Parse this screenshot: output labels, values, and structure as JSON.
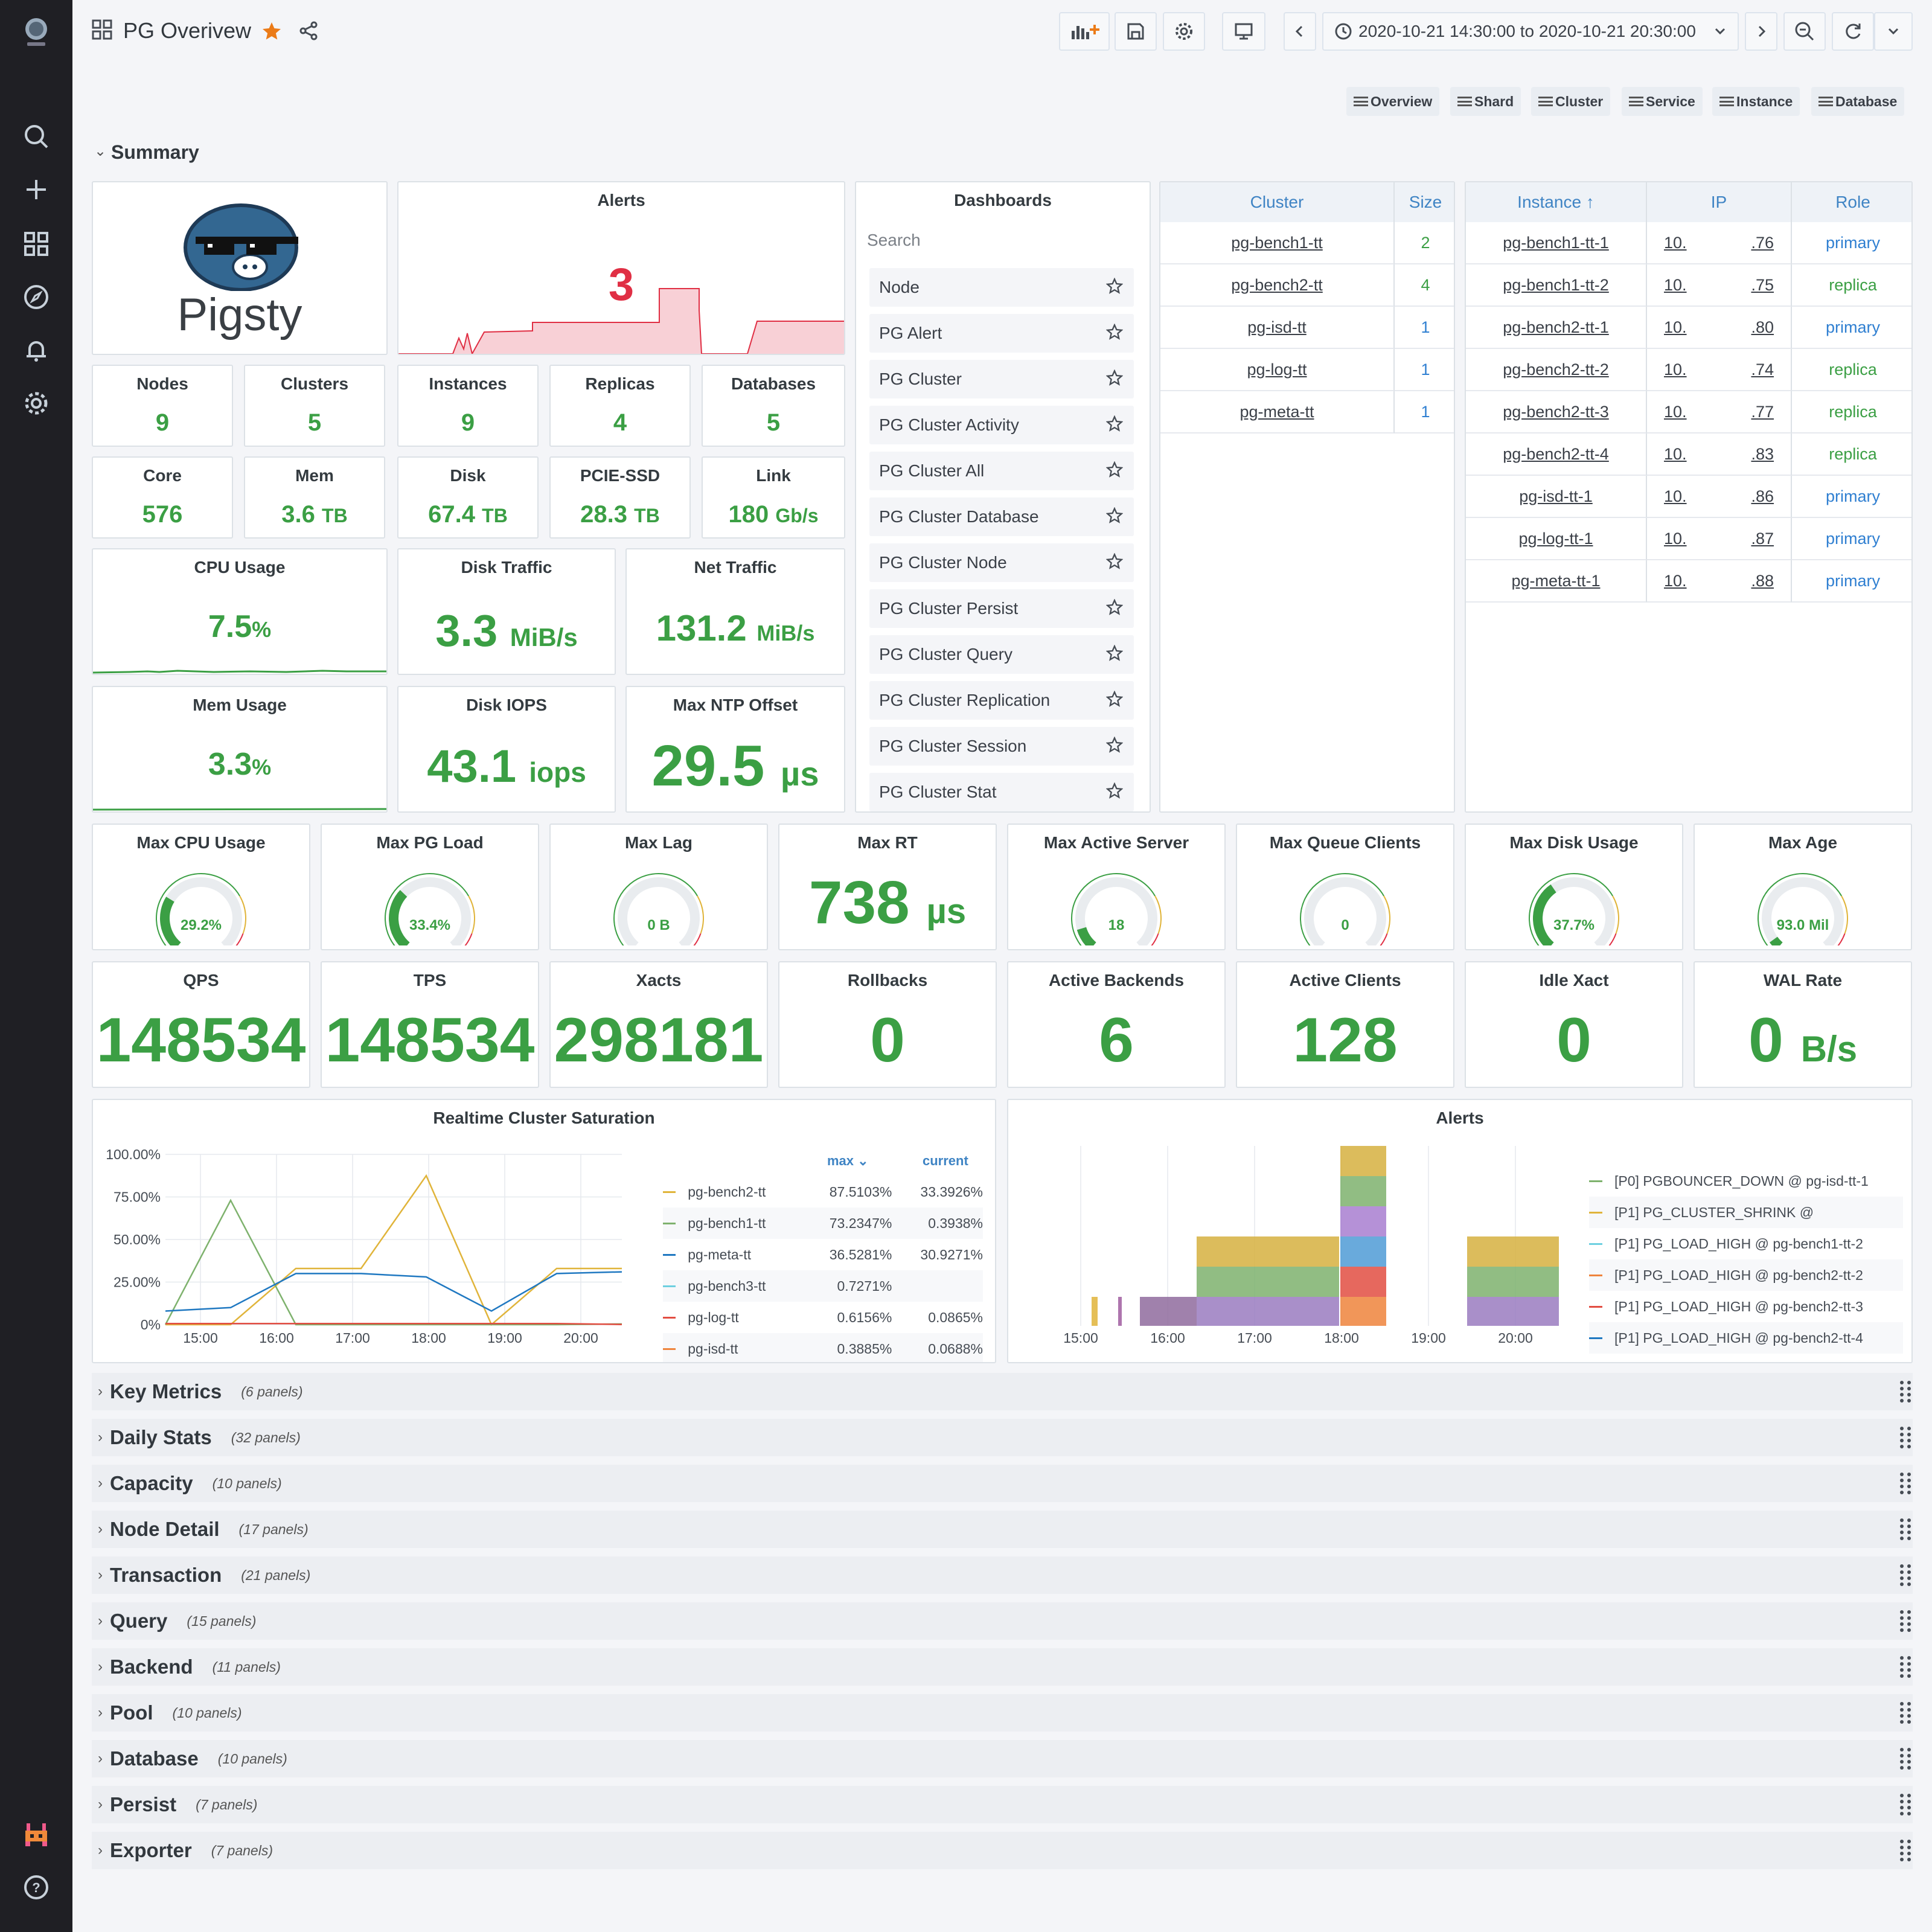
{
  "header": {
    "title": "PG Overivew",
    "time_range": "2020-10-21 14:30:00 to 2020-10-21 20:30:00",
    "links": [
      "Overview",
      "Shard",
      "Cluster",
      "Service",
      "Instance",
      "Database"
    ]
  },
  "summary": {
    "title": "Summary",
    "logo_text": "Pigsty",
    "alerts": {
      "title": "Alerts",
      "value": "3",
      "color": "#e02f44"
    },
    "counts": [
      {
        "label": "Nodes",
        "value": "9"
      },
      {
        "label": "Clusters",
        "value": "5"
      },
      {
        "label": "Instances",
        "value": "9"
      },
      {
        "label": "Replicas",
        "value": "4"
      },
      {
        "label": "Databases",
        "value": "5"
      }
    ],
    "resources": [
      {
        "label": "Core",
        "value": "576",
        "unit": ""
      },
      {
        "label": "Mem",
        "value": "3.6",
        "unit": "TB"
      },
      {
        "label": "Disk",
        "value": "67.4",
        "unit": "TB"
      },
      {
        "label": "PCIE-SSD",
        "value": "28.3",
        "unit": "TB"
      },
      {
        "label": "Link",
        "value": "180",
        "unit": "Gb/s"
      }
    ],
    "cpu_usage": {
      "label": "CPU Usage",
      "value": "7.5",
      "unit": "%"
    },
    "mem_usage": {
      "label": "Mem Usage",
      "value": "3.3",
      "unit": "%"
    },
    "disk_traffic": {
      "label": "Disk Traffic",
      "value": "3.3",
      "unit": "MiB/s"
    },
    "net_traffic": {
      "label": "Net Traffic",
      "value": "131.2",
      "unit": "MiB/s"
    },
    "disk_iops": {
      "label": "Disk IOPS",
      "value": "43.1",
      "unit": "iops"
    },
    "ntp_offset": {
      "label": "Max NTP Offset",
      "value": "29.5",
      "unit": "µs"
    }
  },
  "dashboards": {
    "title": "Dashboards",
    "search_placeholder": "Search",
    "items": [
      "Node",
      "PG Alert",
      "PG Cluster",
      "PG Cluster Activity",
      "PG Cluster All",
      "PG Cluster Database",
      "PG Cluster Node",
      "PG Cluster Persist",
      "PG Cluster Query",
      "PG Cluster Replication",
      "PG Cluster Session",
      "PG Cluster Stat"
    ]
  },
  "cluster_table": {
    "headers": [
      "Cluster",
      "Size"
    ],
    "rows": [
      {
        "cluster": "pg-bench1-tt",
        "size": "2"
      },
      {
        "cluster": "pg-bench2-tt",
        "size": "4"
      },
      {
        "cluster": "pg-isd-tt",
        "size": "1"
      },
      {
        "cluster": "pg-log-tt",
        "size": "1"
      },
      {
        "cluster": "pg-meta-tt",
        "size": "1"
      }
    ]
  },
  "instance_table": {
    "headers": [
      "Instance ↑",
      "IP",
      "Role"
    ],
    "rows": [
      {
        "instance": "pg-bench1-tt-1",
        "ip_a": "10.",
        "ip_b": ".76",
        "role": "primary"
      },
      {
        "instance": "pg-bench1-tt-2",
        "ip_a": "10.",
        "ip_b": ".75",
        "role": "replica"
      },
      {
        "instance": "pg-bench2-tt-1",
        "ip_a": "10.",
        "ip_b": ".80",
        "role": "primary"
      },
      {
        "instance": "pg-bench2-tt-2",
        "ip_a": "10.",
        "ip_b": ".74",
        "role": "replica"
      },
      {
        "instance": "pg-bench2-tt-3",
        "ip_a": "10.",
        "ip_b": ".77",
        "role": "replica"
      },
      {
        "instance": "pg-bench2-tt-4",
        "ip_a": "10.",
        "ip_b": ".83",
        "role": "replica"
      },
      {
        "instance": "pg-isd-tt-1",
        "ip_a": "10.",
        "ip_b": ".86",
        "role": "primary"
      },
      {
        "instance": "pg-log-tt-1",
        "ip_a": "10.",
        "ip_b": ".87",
        "role": "primary"
      },
      {
        "instance": "pg-meta-tt-1",
        "ip_a": "10.",
        "ip_b": ".88",
        "role": "primary"
      }
    ]
  },
  "gauges": [
    {
      "label": "Max CPU Usage",
      "text": "29.2%",
      "fraction": 0.292
    },
    {
      "label": "Max PG Load",
      "text": "33.4%",
      "fraction": 0.334
    },
    {
      "label": "Max Lag",
      "text": "0 B",
      "fraction": 0
    },
    {
      "label": "Max RT",
      "text": "738",
      "unit": "µs",
      "is_stat": true
    },
    {
      "label": "Max Active Server",
      "text": "18",
      "fraction": 0.12
    },
    {
      "label": "Max Queue Clients",
      "text": "0",
      "fraction": 0
    },
    {
      "label": "Max Disk Usage",
      "text": "37.7%",
      "fraction": 0.377
    },
    {
      "label": "Max Age",
      "text": "93.0 Mil",
      "fraction": 0.05
    }
  ],
  "db_stats": [
    {
      "label": "QPS",
      "value": "148534",
      "unit": ""
    },
    {
      "label": "TPS",
      "value": "148534",
      "unit": ""
    },
    {
      "label": "Xacts",
      "value": "298181",
      "unit": ""
    },
    {
      "label": "Rollbacks",
      "value": "0",
      "unit": ""
    },
    {
      "label": "Active Backends",
      "value": "6",
      "unit": ""
    },
    {
      "label": "Active Clients",
      "value": "128",
      "unit": ""
    },
    {
      "label": "Idle Xact",
      "value": "0",
      "unit": ""
    },
    {
      "label": "WAL Rate",
      "value": "0",
      "unit": "B/s"
    }
  ],
  "saturation": {
    "title": "Realtime Cluster Saturation",
    "legend_headers": {
      "max": "max",
      "current": "current"
    },
    "legend": [
      {
        "name": "pg-bench2-tt",
        "max": "87.5103%",
        "current": "33.3926%",
        "color": "#e0b43a"
      },
      {
        "name": "pg-bench1-tt",
        "max": "73.2347%",
        "current": "0.3938%",
        "color": "#7eb26d"
      },
      {
        "name": "pg-meta-tt",
        "max": "36.5281%",
        "current": "30.9271%",
        "color": "#1f78c1"
      },
      {
        "name": "pg-bench3-tt",
        "max": "0.7271%",
        "current": "",
        "color": "#6ed0e0"
      },
      {
        "name": "pg-log-tt",
        "max": "0.6156%",
        "current": "0.0865%",
        "color": "#e24d42"
      },
      {
        "name": "pg-isd-tt",
        "max": "0.3885%",
        "current": "0.0688%",
        "color": "#ef843c"
      }
    ]
  },
  "alerts_chart": {
    "title": "Alerts",
    "legend": [
      {
        "name": "[P0] PGBOUNCER_DOWN @ pg-isd-tt-1",
        "color": "#7eb26d"
      },
      {
        "name": "[P1] PG_CLUSTER_SHRINK @",
        "color": "#e0b43a"
      },
      {
        "name": "[P1] PG_LOAD_HIGH @ pg-bench1-tt-2",
        "color": "#6ed0e0"
      },
      {
        "name": "[P1] PG_LOAD_HIGH @ pg-bench2-tt-2",
        "color": "#ef843c"
      },
      {
        "name": "[P1] PG_LOAD_HIGH @ pg-bench2-tt-3",
        "color": "#e24d42"
      },
      {
        "name": "[P1] PG_LOAD_HIGH @ pg-bench2-tt-4",
        "color": "#1f78c1"
      }
    ]
  },
  "chart_data": [
    {
      "type": "line",
      "title": "Realtime Cluster Saturation",
      "x": [
        "15:00",
        "16:00",
        "17:00",
        "18:00",
        "19:00",
        "20:00"
      ],
      "ylim": [
        0,
        100
      ],
      "yticks": [
        "0%",
        "25.00%",
        "50.00%",
        "75.00%",
        "100.00%"
      ],
      "series": [
        {
          "name": "pg-bench2-tt",
          "values": [
            0,
            0,
            33,
            33,
            87.5,
            0,
            33,
            33
          ]
        },
        {
          "name": "pg-bench1-tt",
          "values": [
            0,
            73,
            0,
            0,
            0,
            0,
            0,
            0.4
          ]
        },
        {
          "name": "pg-meta-tt",
          "values": [
            8,
            10,
            30,
            30,
            28,
            8,
            30,
            31
          ]
        },
        {
          "name": "pg-log-tt",
          "values": [
            0.6,
            0.6,
            0.6,
            0.6,
            0.6,
            0.6,
            0.6,
            0.1
          ]
        }
      ]
    },
    {
      "type": "bar",
      "title": "Alerts",
      "x": [
        "15:00",
        "16:00",
        "17:00",
        "18:00",
        "19:00",
        "20:00"
      ]
    }
  ],
  "rows": [
    {
      "name": "Key Metrics",
      "count": "(6 panels)"
    },
    {
      "name": "Daily Stats",
      "count": "(32 panels)"
    },
    {
      "name": "Capacity",
      "count": "(10 panels)"
    },
    {
      "name": "Node Detail",
      "count": "(17 panels)"
    },
    {
      "name": "Transaction",
      "count": "(21 panels)"
    },
    {
      "name": "Query",
      "count": "(15 panels)"
    },
    {
      "name": "Backend",
      "count": "(11 panels)"
    },
    {
      "name": "Pool",
      "count": "(10 panels)"
    },
    {
      "name": "Database",
      "count": "(10 panels)"
    },
    {
      "name": "Persist",
      "count": "(7 panels)"
    },
    {
      "name": "Exporter",
      "count": "(7 panels)"
    }
  ]
}
